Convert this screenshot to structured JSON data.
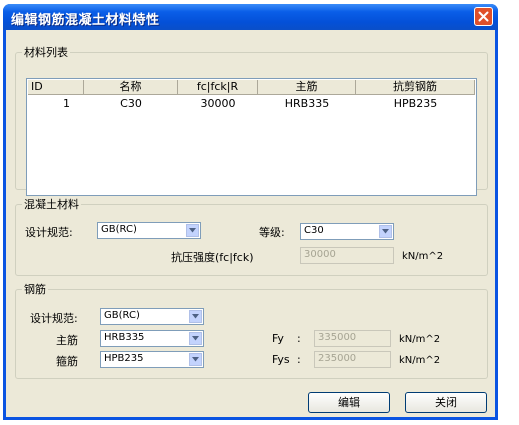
{
  "window": {
    "title": "编辑钢筋混凝土材料特性"
  },
  "materials": {
    "legend": "材料列表",
    "columns": [
      "ID",
      "名称",
      "fc|fck|R",
      "主筋",
      "抗剪钢筋"
    ],
    "rows": [
      [
        "1",
        "C30",
        "30000",
        "HRB335",
        "HPB235"
      ]
    ]
  },
  "concrete": {
    "legend": "混凝土材料",
    "code_label": "设计规范:",
    "code_value": "GB(RC)",
    "grade_label": "等级:",
    "grade_value": "C30",
    "strength_label": "抗压强度(fc|fck)",
    "strength_value": "30000",
    "strength_unit": "kN/m^2"
  },
  "rebar": {
    "legend": "钢筋",
    "code_label": "设计规范:",
    "code_value": "GB(RC)",
    "main_label": "主筋",
    "main_value": "HRB335",
    "stirrup_label": "箍筋",
    "stirrup_value": "HPB235",
    "fy_label": "Fy",
    "fy_colon": ":",
    "fy_value": "335000",
    "fy_unit": "kN/m^2",
    "fys_label": "Fys",
    "fys_colon": ":",
    "fys_value": "235000",
    "fys_unit": "kN/m^2"
  },
  "buttons": {
    "edit": "编辑",
    "close": "关闭"
  },
  "colors": {
    "titlebar": "#0a5ee8",
    "dialog_bg": "#ece9d8",
    "close_button": "#e0502a"
  },
  "icons": {
    "close": "close-x-icon",
    "dropdown": "chevron-down-icon"
  }
}
